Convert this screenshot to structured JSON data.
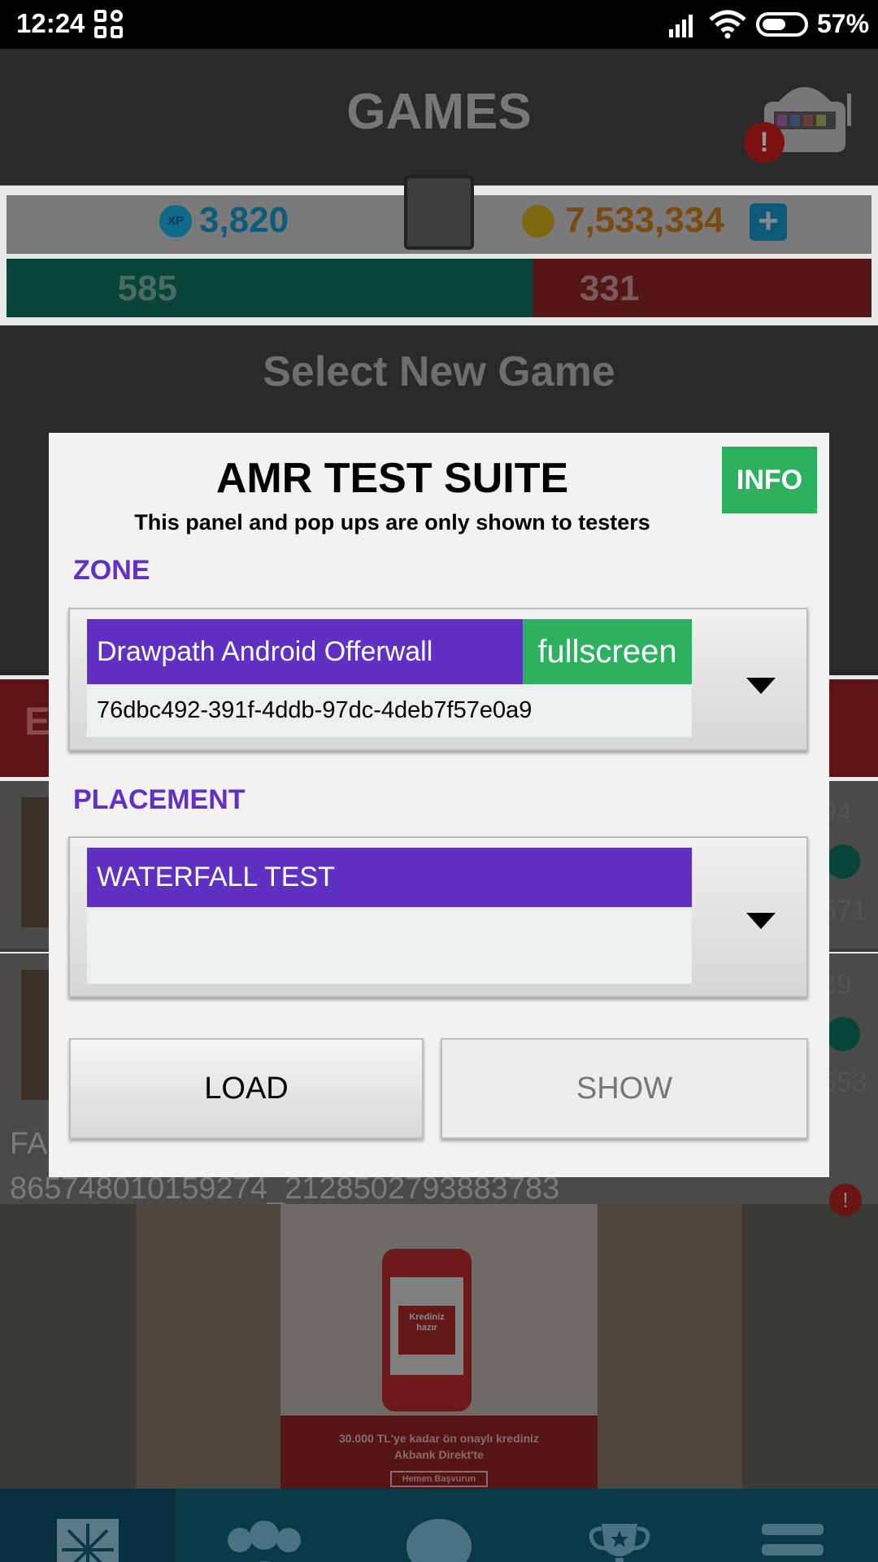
{
  "status_bar": {
    "time": "12:24",
    "battery_percent": "57%",
    "battery_level": 0.57
  },
  "app": {
    "title": "GAMES",
    "xp_icon_text": "XP",
    "xp": "3,820",
    "coins": "7,533,334",
    "plus_label": "+",
    "alert_label": "!",
    "score_green": "585",
    "score_red": "331",
    "select_title": "Select New Game",
    "banner_partial": "E",
    "list": [
      {
        "num_top": "94",
        "num_bottom": "571"
      },
      {
        "num_top": "39",
        "num_bottom": "553"
      }
    ],
    "ad_line1": "FA",
    "ad_line2": "865748010159274_2128502793883783",
    "ad_phone_text": "Krediniz hazır",
    "ad_headline1": "30.000 TL'ye kadar ön onaylı krediniz",
    "ad_headline2": "Akbank Direkt'te",
    "ad_cta": "Hemen Başvurun"
  },
  "bottom_nav": [
    {
      "icon": "games-icon"
    },
    {
      "icon": "friends-icon"
    },
    {
      "icon": "chat-icon"
    },
    {
      "icon": "trophy-icon"
    },
    {
      "icon": "menu-icon"
    }
  ],
  "dialog": {
    "title": "AMR TEST SUITE",
    "subtitle": "This panel and pop ups are only shown to testers",
    "info_label": "INFO",
    "zone_label": "ZONE",
    "zone": {
      "name": "Drawpath Android Offerwall",
      "type": "fullscreen",
      "id": "76dbc492-391f-4ddb-97dc-4deb7f57e0a9"
    },
    "placement_label": "PLACEMENT",
    "placement": {
      "name": "WATERFALL TEST"
    },
    "load_label": "LOAD",
    "show_label": "SHOW"
  },
  "colors": {
    "accent_purple": "#5f30c2",
    "accent_green": "#2db15e"
  }
}
